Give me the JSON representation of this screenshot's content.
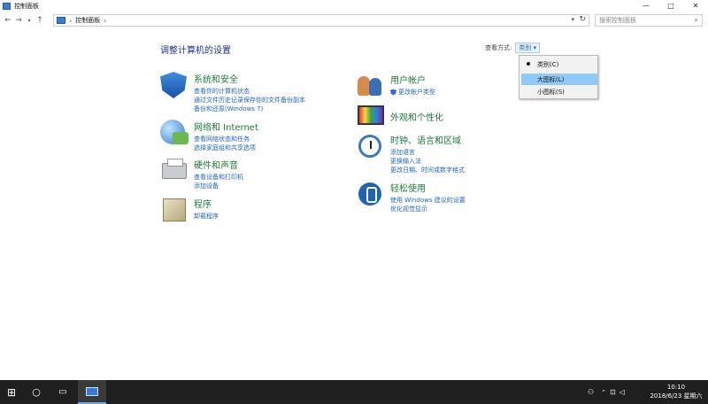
{
  "window": {
    "title": "控制面板",
    "min": "—",
    "max": "□",
    "close": "✕"
  },
  "address": {
    "crumb": "控制面板",
    "search_placeholder": "搜索控制面板"
  },
  "main": {
    "heading": "调整计算机的设置",
    "viewby_label": "查看方式:",
    "viewby_value": "类别 ▾"
  },
  "categories": [
    {
      "id": "system-security",
      "title": "系统和安全",
      "links": [
        "查看你的计算机状态",
        "通过文件历史记录保存你的文件备份副本",
        "备份和还原(Windows 7)"
      ]
    },
    {
      "id": "network",
      "title": "网络和 Internet",
      "links": [
        "查看网络状态和任务",
        "选择家庭组和共享选项"
      ]
    },
    {
      "id": "hardware",
      "title": "硬件和声音",
      "links": [
        "查看设备和打印机",
        "添加设备"
      ]
    },
    {
      "id": "programs",
      "title": "程序",
      "links": [
        "卸载程序"
      ]
    },
    {
      "id": "users",
      "title": "用户帐户",
      "links": [
        "更改帐户类型"
      ]
    },
    {
      "id": "appearance",
      "title": "外观和个性化",
      "links": []
    },
    {
      "id": "clock",
      "title": "时钟、语言和区域",
      "links": [
        "添加语言",
        "更换输入法",
        "更改日期、时间或数字格式"
      ]
    },
    {
      "id": "ease",
      "title": "轻松使用",
      "links": [
        "使用 Windows 建议的设置",
        "优化视觉显示"
      ]
    }
  ],
  "dropdown": {
    "items": [
      "类别(C)",
      "大图标(L)",
      "小图标(S)"
    ],
    "checked_index": 0,
    "highlighted_index": 1
  },
  "taskbar": {
    "time": "10:10",
    "date": "2018/6/23 星期六"
  }
}
